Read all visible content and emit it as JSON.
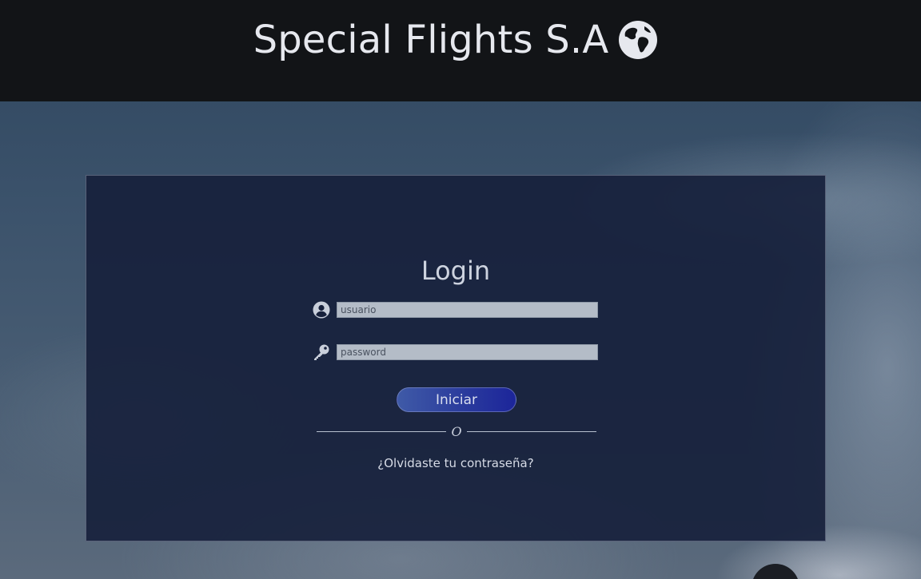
{
  "header": {
    "title": "Special Flights S.A",
    "icon": "globe-icon"
  },
  "login": {
    "title": "Login",
    "username": {
      "icon": "user-circle-icon",
      "placeholder": "usuario",
      "value": ""
    },
    "password": {
      "icon": "key-icon",
      "placeholder": "password",
      "value": ""
    },
    "submit_label": "Iniciar",
    "divider_text": "O",
    "forgot_label": "¿Olvidaste tu contraseña?"
  },
  "colors": {
    "header_bg": "#121417",
    "panel_bg": "#17213c",
    "button_start": "#3f5aa7",
    "button_end": "#1c259a",
    "input_bg": "#b4bcc7",
    "text_light": "#cdd3df"
  }
}
